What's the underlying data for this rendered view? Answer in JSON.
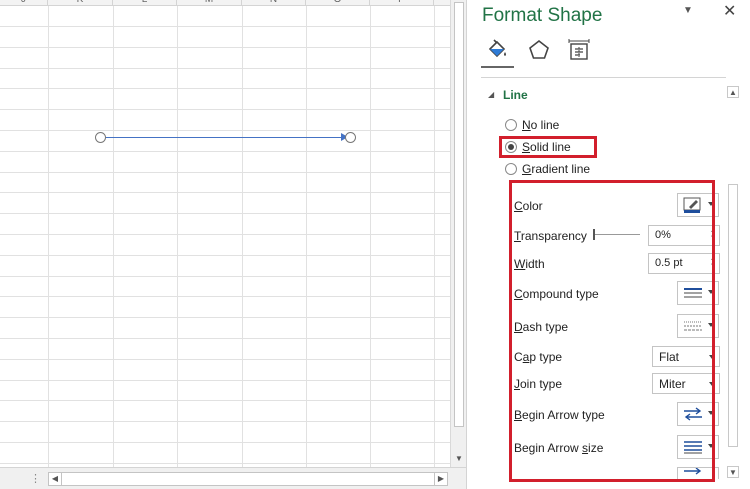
{
  "sheet": {
    "columns": [
      "J",
      "K",
      "L",
      "M",
      "N",
      "O",
      "P"
    ]
  },
  "pane": {
    "title": "Format Shape",
    "menu_glyph": "▼",
    "close_glyph": "✕",
    "tabs": [
      {
        "name": "Fill & Line",
        "icon": "paint-bucket-icon"
      },
      {
        "name": "Effects",
        "icon": "pentagon-icon"
      },
      {
        "name": "Size & Properties",
        "icon": "size-properties-icon"
      }
    ],
    "section": {
      "title": "Line",
      "caret": "◢"
    },
    "line_options": [
      {
        "prefix": "",
        "accel": "N",
        "rest": "o line",
        "checked": false
      },
      {
        "prefix": "",
        "accel": "S",
        "rest": "olid line",
        "checked": true
      },
      {
        "prefix": "",
        "accel": "G",
        "rest": "radient line",
        "checked": false
      }
    ],
    "properties": {
      "color": {
        "prefix": "",
        "accel": "C",
        "rest": "olor",
        "accent": "#1f4e9c"
      },
      "transparency": {
        "prefix": "",
        "accel": "T",
        "rest": "ransparency",
        "value": "0%"
      },
      "width": {
        "prefix": "",
        "accel": "W",
        "rest": "idth",
        "value": "0.5 pt"
      },
      "compound_type": {
        "prefix": "",
        "accel": "C",
        "rest": "ompound type"
      },
      "dash_type": {
        "prefix": "",
        "accel": "D",
        "rest": "ash type"
      },
      "cap_type": {
        "prefix": "C",
        "accel": "a",
        "rest": "p type",
        "value": "Flat"
      },
      "join_type": {
        "prefix": "",
        "accel": "J",
        "rest": "oin type",
        "value": "Miter"
      },
      "begin_arrow_type": {
        "prefix": "",
        "accel": "B",
        "rest": "egin Arrow type"
      },
      "begin_arrow_size": {
        "prefix": "Begin Arrow ",
        "accel": "s",
        "rest": "ize"
      }
    },
    "highlight_color": "#d21f2c"
  }
}
